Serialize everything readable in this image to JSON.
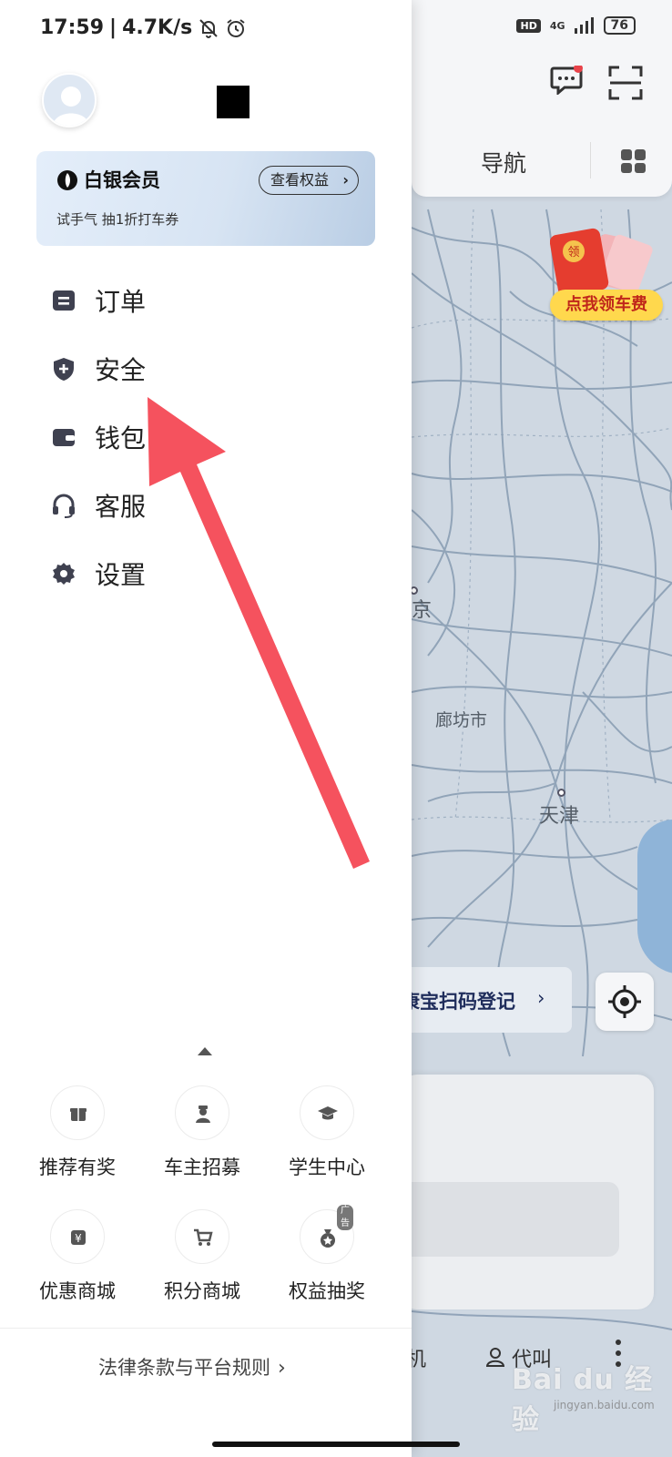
{
  "status_bar": {
    "time": "17:59",
    "speed": "4.7K/s",
    "hd": "HD",
    "network": "4G",
    "battery": "76"
  },
  "drawer": {
    "member": {
      "title": "白银会员",
      "button": "查看权益",
      "subtitle": "试手气 抽1折打车券"
    },
    "menu": [
      {
        "label": "订单",
        "icon": "order-icon"
      },
      {
        "label": "安全",
        "icon": "shield-plus-icon"
      },
      {
        "label": "钱包",
        "icon": "wallet-icon"
      },
      {
        "label": "客服",
        "icon": "headset-icon"
      },
      {
        "label": "设置",
        "icon": "gear-icon"
      }
    ],
    "services": [
      {
        "label": "推荐有奖",
        "icon": "gift-icon"
      },
      {
        "label": "车主招募",
        "icon": "driver-icon"
      },
      {
        "label": "学生中心",
        "icon": "graduation-cap-icon"
      },
      {
        "label": "优惠商城",
        "icon": "yen-bag-icon"
      },
      {
        "label": "积分商城",
        "icon": "cart-icon"
      },
      {
        "label": "权益抽奖",
        "icon": "prize-bag-icon",
        "badge": "广告"
      }
    ],
    "legal_link": "法律条款与平台规则"
  },
  "map": {
    "tab_label": "导航",
    "promo": "点我领车费",
    "promo_coin": "领",
    "cities": [
      "京",
      "廊坊市",
      "天津"
    ],
    "scan_banner": "康宝扫码登记",
    "bottom_nav": [
      "机",
      "代叫"
    ]
  },
  "watermark": {
    "text": "Bai du 经验",
    "sub": "jingyan.baidu.com"
  },
  "colors": {
    "arrow": "#f5525e",
    "map_bg": "#cfd8e2",
    "road": "#7d93ab",
    "promo_yellow": "#ffd84d",
    "promo_red": "#c0271b"
  }
}
